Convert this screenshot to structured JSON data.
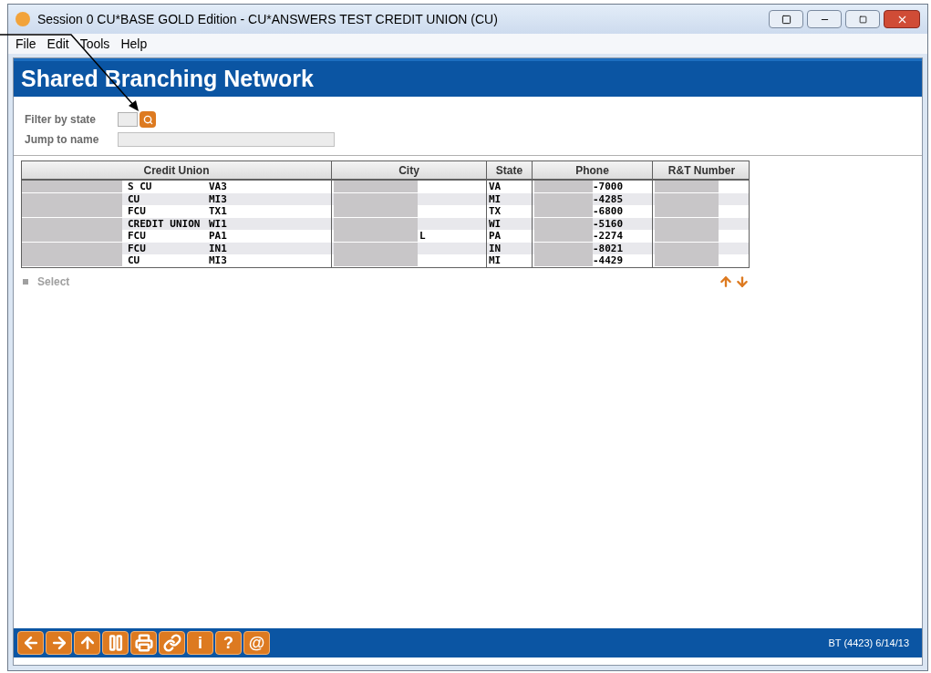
{
  "window": {
    "title": "Session 0 CU*BASE GOLD Edition - CU*ANSWERS TEST CREDIT UNION (CU)"
  },
  "menu": [
    "File",
    "Edit",
    "Tools",
    "Help"
  ],
  "page_title": "Shared Branching Network",
  "filters": [
    {
      "label": "Filter by state",
      "kind": "state"
    },
    {
      "label": "Jump to name",
      "kind": "name"
    }
  ],
  "table": {
    "columns": [
      "Credit Union",
      "City",
      "State",
      "Phone",
      "R&T Number"
    ],
    "rows": [
      {
        "name": "S CU",
        "code": "VA3",
        "city": "",
        "state": "VA",
        "phone": "-7000"
      },
      {
        "name": "CU",
        "code": "MI3",
        "city": "",
        "state": "MI",
        "phone": "-4285"
      },
      {
        "name": "FCU",
        "code": "TX1",
        "city": "",
        "state": "TX",
        "phone": "-6800"
      },
      {
        "name": "CREDIT UNION",
        "code": "WI1",
        "city": "",
        "state": "WI",
        "phone": "-5160"
      },
      {
        "name": "FCU",
        "code": "PA1",
        "city": "L",
        "state": "PA",
        "phone": "-2274"
      },
      {
        "name": "FCU",
        "code": "IN1",
        "city": "",
        "state": "IN",
        "phone": "-8021"
      },
      {
        "name": "CU",
        "code": "MI3",
        "city": "",
        "state": "MI",
        "phone": "-4429"
      }
    ]
  },
  "select_action": {
    "label": "Select",
    "disabled": true
  },
  "toolbar": [
    {
      "kind": "back"
    },
    {
      "kind": "forward"
    },
    {
      "kind": "up"
    },
    {
      "kind": "pause"
    },
    {
      "kind": "print"
    },
    {
      "kind": "link"
    },
    {
      "kind": "text",
      "text": "i"
    },
    {
      "kind": "text",
      "text": "?"
    },
    {
      "kind": "text",
      "text": "@"
    }
  ],
  "status": "BT (4423) 6/14/13"
}
